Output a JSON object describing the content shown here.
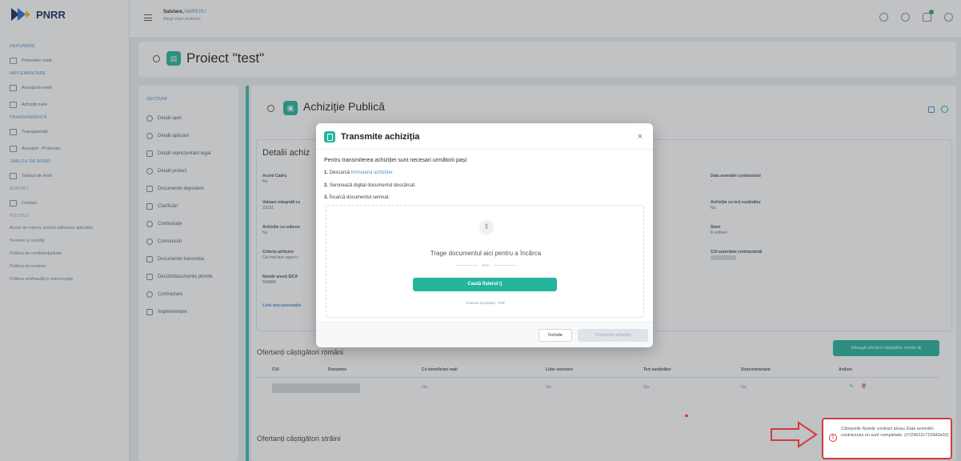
{
  "app": {
    "logo_text": "PNRR",
    "brand_color": "#1a2b5a",
    "accent": "#25b49c"
  },
  "sidebar": {
    "sections": [
      {
        "head": "DEPUNERE",
        "items": [
          {
            "label": "Proiectele mele",
            "icon": "clipboard-icon"
          }
        ]
      },
      {
        "head": "IMPLEMENTARE",
        "items": [
          {
            "label": "Anunțurile mele",
            "icon": "folder-icon"
          },
          {
            "label": "Achiziții mele",
            "icon": "document-icon"
          }
        ]
      },
      {
        "head": "TRANSPARENȚĂ",
        "items": [
          {
            "label": "Transparență",
            "icon": "grid-icon"
          },
          {
            "label": "Anunțuri - Proiectari",
            "icon": "search-doc-icon"
          }
        ]
      },
      {
        "head": "TABLOU DE BORD",
        "items": [
          {
            "label": "Tabloul de bord",
            "icon": "monitor-icon"
          }
        ]
      },
      {
        "head": "SUPORT",
        "items": [
          {
            "label": "Contact",
            "icon": "mail-icon"
          }
        ]
      }
    ],
    "politici_head": "POLITICI",
    "politici": [
      "Acord de interes privind utilizarea aplicației",
      "Termeni și condiții",
      "Politica de confidențialitate",
      "Politica de cookies",
      "Politica antifraudă și anticorupție"
    ]
  },
  "topbar": {
    "greeting": "Salutare,",
    "user": "MARIUS I",
    "sub": "Alegi clare proiecte"
  },
  "project": {
    "title": "Proiect \"test\""
  },
  "sections": {
    "title": "SECȚIUNI",
    "items": [
      "Detalii apel",
      "Detalii aplicant",
      "Detalii reprezentant legal",
      "Detalii proiect",
      "Documente depunere",
      "Clarificări",
      "Contestație",
      "Comunicări",
      "Documente transmise",
      "Decizii/documente primite",
      "Contractare",
      "Implementare"
    ]
  },
  "main": {
    "title": "Achiziție Publică",
    "details_title": "Detalii achiz",
    "fields_left": [
      {
        "label": "Acord Cadru",
        "value": "Nu"
      },
      {
        "label": "Valoare integrală cu",
        "value": "22131"
      },
      {
        "label": "Achiziție cu subcon",
        "value": "Nu"
      },
      {
        "label": "Criteriu atribuire",
        "value": "Cel mai bun raport c"
      },
      {
        "label": "Număr anunț SICA",
        "value": "556888"
      }
    ],
    "fields_right": [
      {
        "label": "Data semnării contractului",
        "value": "-"
      },
      {
        "label": "Achiziție cu terț susținător",
        "value": "Nu"
      },
      {
        "label": "Stare",
        "value": "În editare"
      },
      {
        "label": "CUI autoritate contractantă",
        "value": ""
      }
    ],
    "link_docs": "Link documentație",
    "winners_ro_title": "Ofertanți câștigători români",
    "add_winner_btn": "Adaugă ofertant câștigător român",
    "table_headers": [
      "CUI",
      "Denumire",
      "Cu beneficiari reali",
      "Lider asociere",
      "Terț susținător",
      "Subcontractant",
      "Acțiuni"
    ],
    "table_row": [
      "",
      "Nu",
      "Nu",
      "Nu",
      "Nu"
    ],
    "winners_foreign_title": "Ofertanți câștigători străini"
  },
  "modal": {
    "title": "Transmite achiziția",
    "close": "×",
    "intro": "Pentru transmiterea achiziției sunt necesari următorii pași:",
    "steps": [
      {
        "num": "1.",
        "text": "Descarcă ",
        "link": "formularul achiziției."
      },
      {
        "num": "2.",
        "text": "Semnează digital documentul descărcat.",
        "link": ""
      },
      {
        "num": "3.",
        "text": "Încarcă documentul semnat.",
        "link": ""
      }
    ],
    "drop_text": "Trage documentul aici pentru a încărca",
    "or": "SAU",
    "browse_btn": "Caută fișierul",
    "accepted": "Extensii acceptate: .PDF",
    "btn_close": "Închide",
    "btn_send": "Transmite achiziția"
  },
  "toast": {
    "text": "Câmpurile Număr contract și/sau Data semnării contractului nu sunt completate. (#729622c7159d3e02)",
    "color": "#d43b3b"
  }
}
